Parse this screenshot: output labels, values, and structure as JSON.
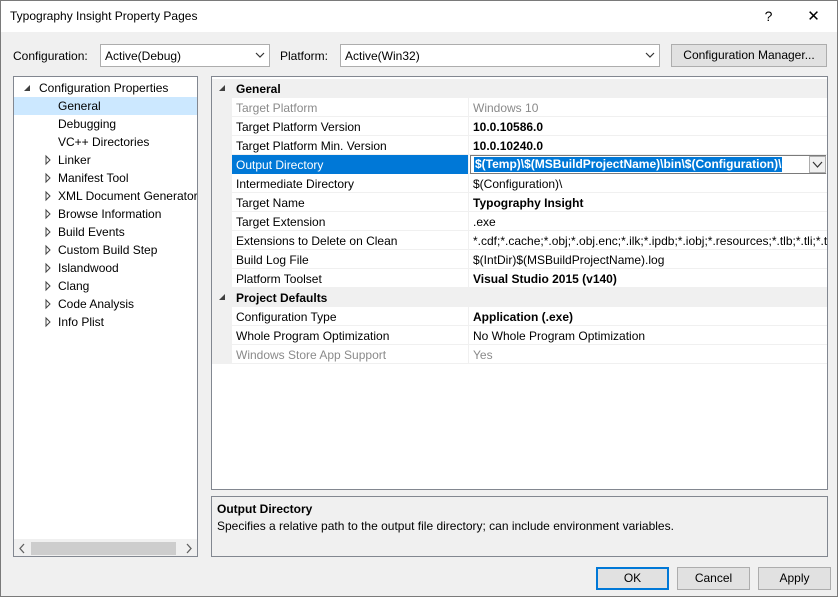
{
  "window": {
    "title": "Typography Insight Property Pages",
    "help_glyph": "?",
    "close_glyph": "✕"
  },
  "toolbar": {
    "configuration_label": "Configuration:",
    "configuration_value": "Active(Debug)",
    "platform_label": "Platform:",
    "platform_value": "Active(Win32)",
    "config_manager_label": "Configuration Manager..."
  },
  "tree": {
    "root": "Configuration Properties",
    "items": [
      {
        "label": "General",
        "expandable": false,
        "selected": true
      },
      {
        "label": "Debugging",
        "expandable": false
      },
      {
        "label": "VC++ Directories",
        "expandable": false
      },
      {
        "label": "Linker",
        "expandable": true
      },
      {
        "label": "Manifest Tool",
        "expandable": true
      },
      {
        "label": "XML Document Generator",
        "expandable": true
      },
      {
        "label": "Browse Information",
        "expandable": true
      },
      {
        "label": "Build Events",
        "expandable": true
      },
      {
        "label": "Custom Build Step",
        "expandable": true
      },
      {
        "label": "Islandwood",
        "expandable": true
      },
      {
        "label": "Clang",
        "expandable": true
      },
      {
        "label": "Code Analysis",
        "expandable": true
      },
      {
        "label": "Info Plist",
        "expandable": true
      }
    ]
  },
  "grid": {
    "general_category": "General",
    "general_rows": [
      {
        "name": "Target Platform",
        "value": "Windows 10",
        "style": "gray"
      },
      {
        "name": "Target Platform Version",
        "value": "10.0.10586.0",
        "style": "bold"
      },
      {
        "name": "Target Platform Min. Version",
        "value": "10.0.10240.0",
        "style": "bold"
      },
      {
        "name": "Output Directory",
        "value": "$(Temp)\\$(MSBuildProjectName)\\bin\\$(Configuration)\\",
        "style": "editing"
      },
      {
        "name": "Intermediate Directory",
        "value": "$(Configuration)\\",
        "style": "normal"
      },
      {
        "name": "Target Name",
        "value": "Typography Insight",
        "style": "bold"
      },
      {
        "name": "Target Extension",
        "value": ".exe",
        "style": "normal"
      },
      {
        "name": "Extensions to Delete on Clean",
        "value": "*.cdf;*.cache;*.obj;*.obj.enc;*.ilk;*.ipdb;*.iobj;*.resources;*.tlb;*.tli;*.t",
        "style": "normal"
      },
      {
        "name": "Build Log File",
        "value": "$(IntDir)$(MSBuildProjectName).log",
        "style": "normal"
      },
      {
        "name": "Platform Toolset",
        "value": "Visual Studio 2015 (v140)",
        "style": "bold"
      }
    ],
    "defaults_category": "Project Defaults",
    "defaults_rows": [
      {
        "name": "Configuration Type",
        "value": "Application (.exe)",
        "style": "bold"
      },
      {
        "name": "Whole Program Optimization",
        "value": "No Whole Program Optimization",
        "style": "normal"
      },
      {
        "name": "Windows Store App Support",
        "value": "Yes",
        "style": "gray"
      }
    ]
  },
  "description": {
    "title": "Output Directory",
    "text": "Specifies a relative path to the output file directory; can include environment variables."
  },
  "buttons": {
    "ok": "OK",
    "cancel": "Cancel",
    "apply": "Apply"
  }
}
